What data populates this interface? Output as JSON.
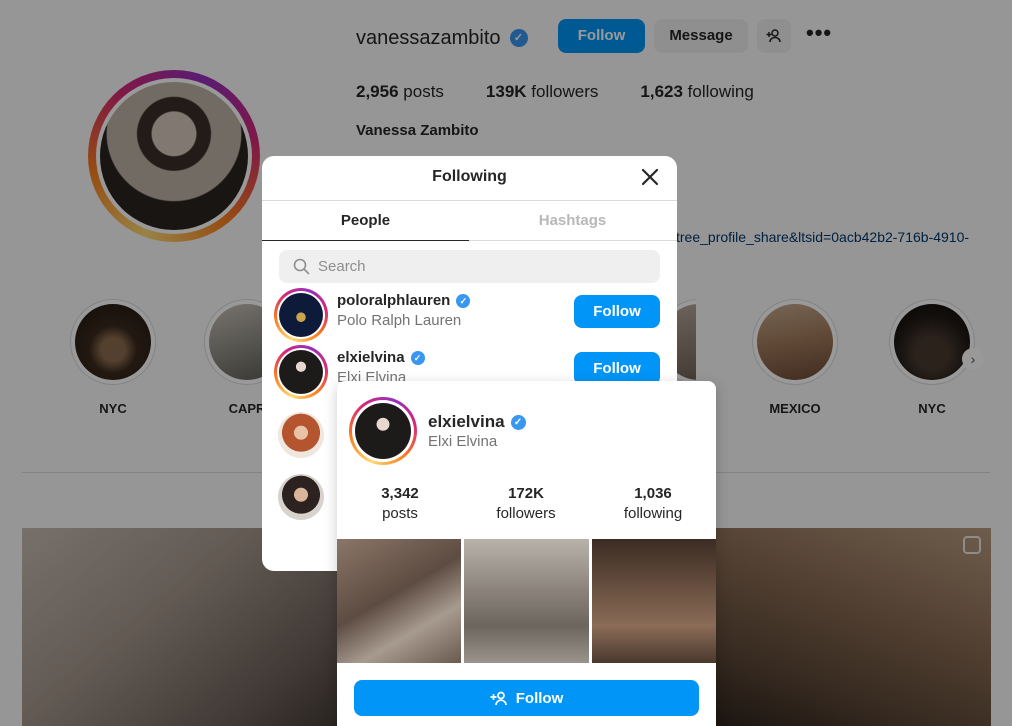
{
  "profile": {
    "username": "vanessazambito",
    "follow_label": "Follow",
    "message_label": "Message",
    "more_label": "•••",
    "stats": {
      "posts_count": "2,956",
      "posts_label": "posts",
      "followers_count": "139K",
      "followers_label": "followers",
      "following_count": "1,623",
      "following_label": "following"
    },
    "full_name": "Vanessa Zambito",
    "bio_link": "tree_profile_share&ltsid=0acb42b2-716b-4910-"
  },
  "highlights": [
    {
      "label": "NYC"
    },
    {
      "label": "CAPR"
    },
    {
      "label": "MEXICO"
    },
    {
      "label": "NYC"
    }
  ],
  "modal": {
    "title": "Following",
    "tabs": [
      "People",
      "Hashtags"
    ],
    "search_placeholder": "Search",
    "rows": [
      {
        "username": "poloralphlauren",
        "name": "Polo Ralph Lauren",
        "button": "Follow"
      },
      {
        "username": "elxielvina",
        "name": "Elxi Elvina",
        "button": "Follow"
      }
    ]
  },
  "hover_card": {
    "username": "elxielvina",
    "name": "Elxi Elvina",
    "stats": [
      {
        "count": "3,342",
        "label": "posts"
      },
      {
        "count": "172K",
        "label": "followers"
      },
      {
        "count": "1,036",
        "label": "following"
      }
    ],
    "follow_label": "Follow"
  },
  "colors": {
    "accent": "#0095f6",
    "verified": "#3897f0"
  }
}
